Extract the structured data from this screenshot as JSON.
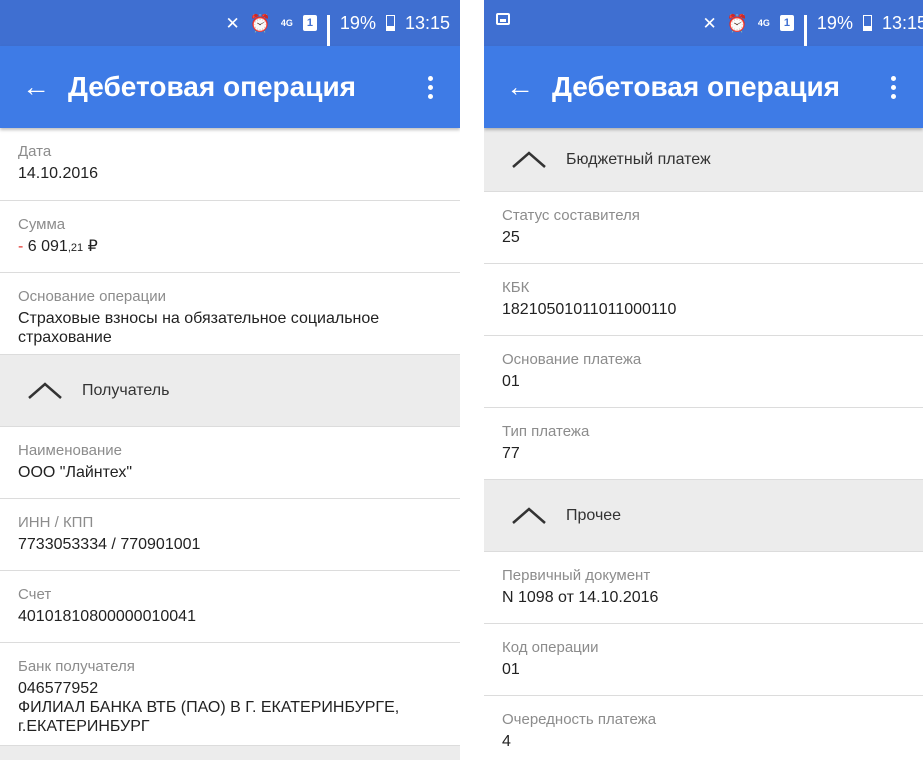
{
  "status_bar": {
    "network_type": "4G",
    "sim": "1",
    "battery": "19%",
    "time": "13:15"
  },
  "left_screen": {
    "title": "Дебетовая операция",
    "fields_top": [
      {
        "label": "Дата",
        "value": "14.10.2016"
      },
      {
        "label": "Сумма",
        "amount_sign": "- ",
        "amount_main": "6 091",
        "amount_kop": ",21",
        "currency": " ₽"
      },
      {
        "label": "Основание операции",
        "value": "Страховые взносы  на обязательное социальное страхование"
      }
    ],
    "section_recipient": "Получатель",
    "fields_recipient": [
      {
        "label": "Наименование",
        "value": "ООО \"Лайнтех\""
      },
      {
        "label": "ИНН / КПП",
        "value": "7733053334 / 770901001"
      },
      {
        "label": "Счет",
        "value": "40101810800000010041"
      },
      {
        "label": "Банк получателя",
        "value_line1": "046577952",
        "value_line2": "ФИЛИАЛ БАНКА ВТБ (ПАО) В Г. ЕКАТЕРИНБУРГЕ, г.ЕКАТЕРИНБУРГ"
      }
    ]
  },
  "right_screen": {
    "title": "Дебетовая операция",
    "section_budget": "Бюджетный платеж",
    "fields_budget": [
      {
        "label": "Статус составителя",
        "value": "25"
      },
      {
        "label": "КБК",
        "value": "18210501011011000110"
      },
      {
        "label": "Основание платежа",
        "value": "01"
      },
      {
        "label": "Тип платежа",
        "value": "77"
      }
    ],
    "section_other": "Прочее",
    "fields_other": [
      {
        "label": "Первичный документ",
        "value": "N 1098 от 14.10.2016"
      },
      {
        "label": "Код операции",
        "value": "01"
      },
      {
        "label": "Очередность платежа",
        "value": "4"
      }
    ]
  },
  "colors": {
    "status_bar": "#3f6fd1",
    "app_bar": "#3e7be6",
    "section_bg": "#ececec",
    "minus_sign": "#e0332b"
  },
  "icons": [
    "back-arrow-icon",
    "more-vert-icon",
    "chevron-up-icon",
    "mute-icon",
    "alarm-icon",
    "signal-icon",
    "battery-icon",
    "gallery-icon"
  ]
}
